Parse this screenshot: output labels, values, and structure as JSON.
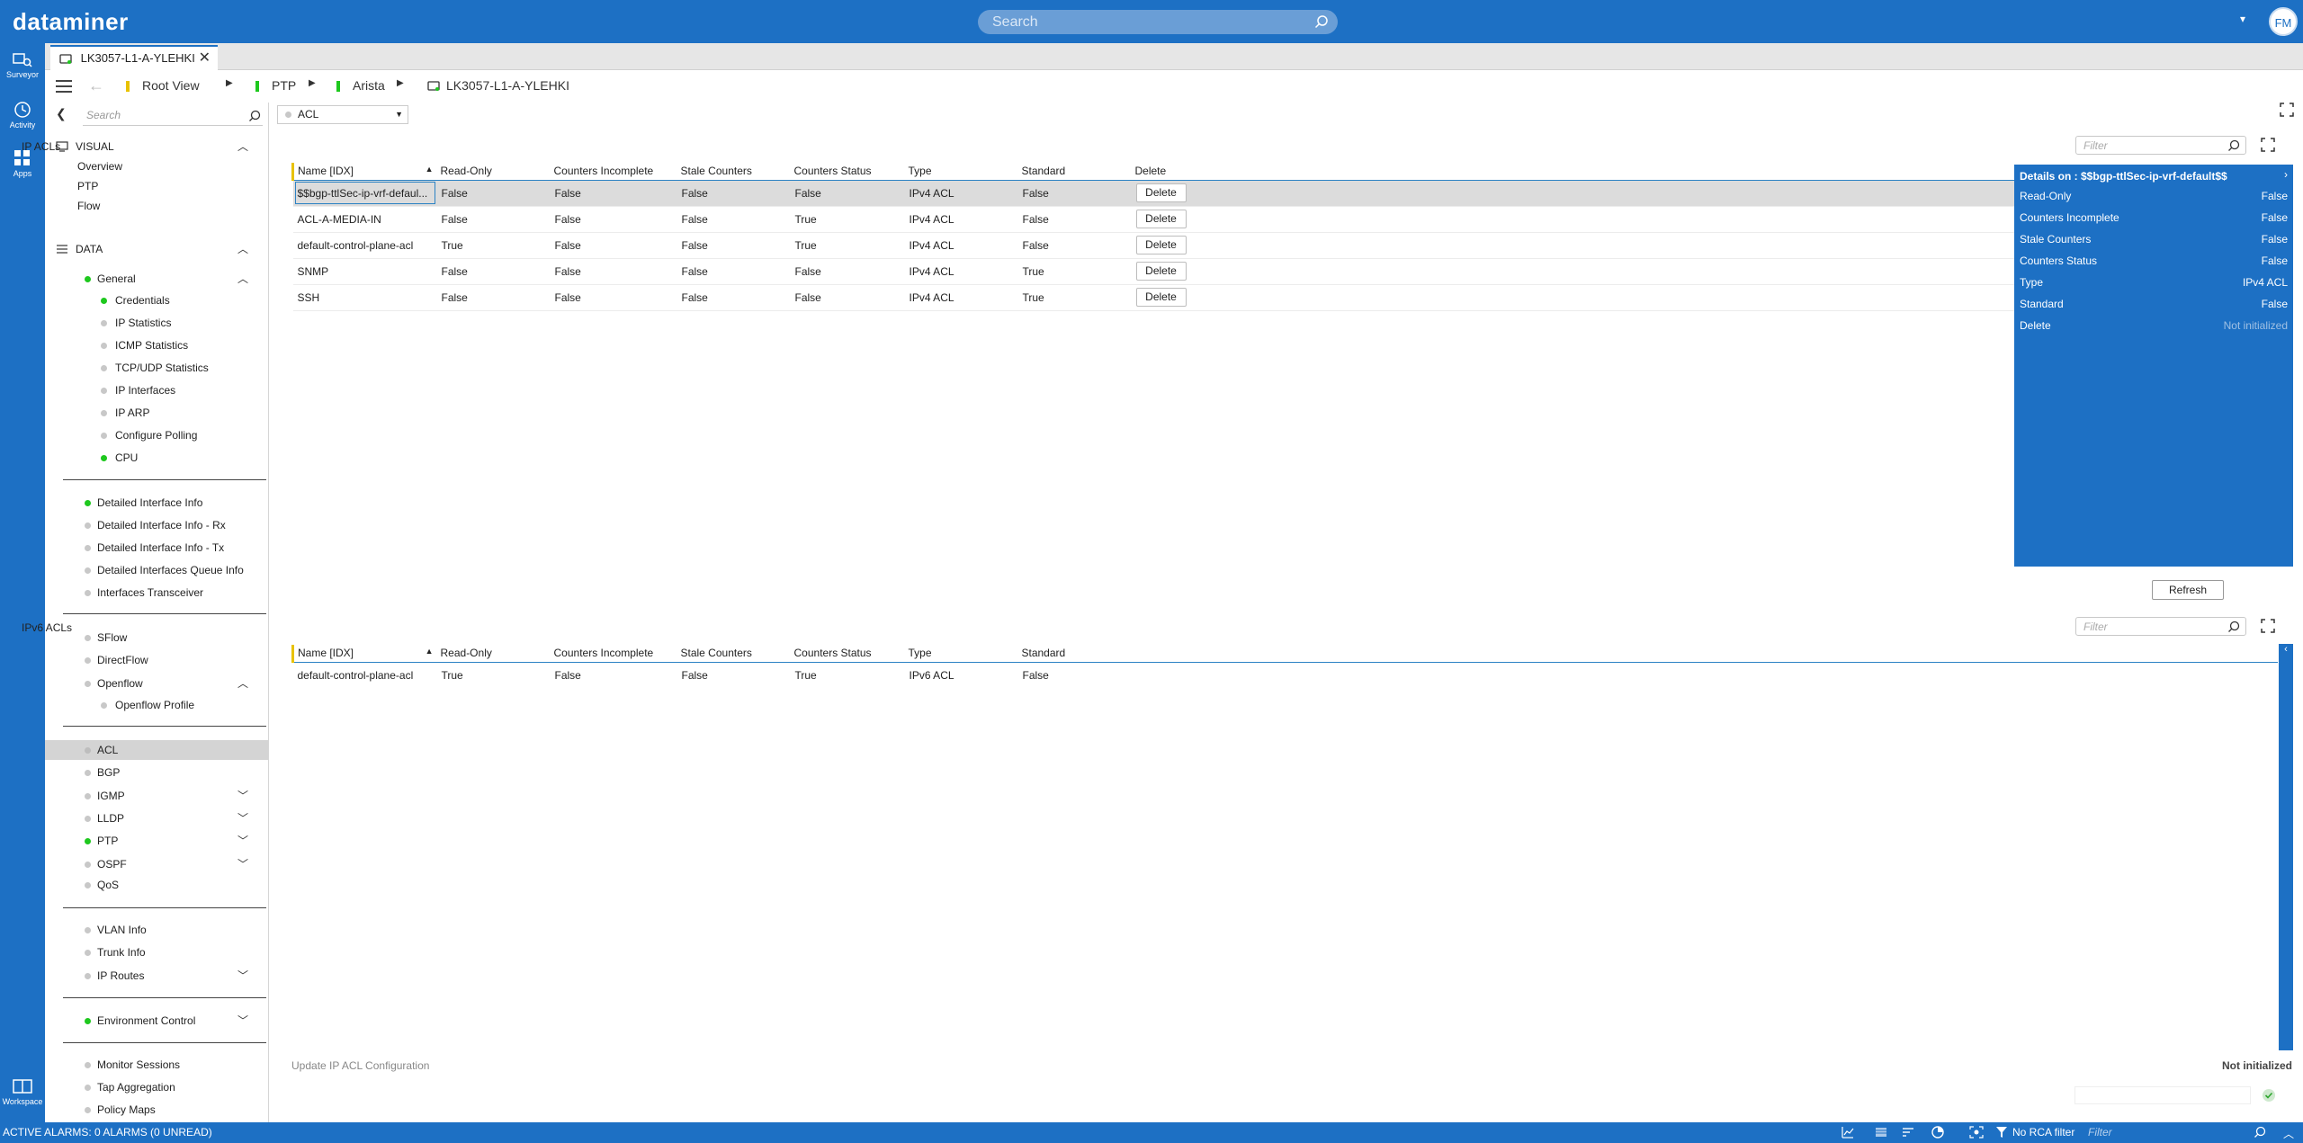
{
  "app": {
    "logo": "dataminer",
    "search_placeholder": "Search",
    "user_initials": "FM",
    "menu_arrow": "▾"
  },
  "rail": {
    "surveyor": "Surveyor",
    "activity": "Activity",
    "apps": "Apps",
    "workspace": "Workspace"
  },
  "tab": {
    "label": "LK3057-L1-A-YLEHKI",
    "close": "✕"
  },
  "breadcrumb": {
    "root": "Root View",
    "ptp": "PTP",
    "arista": "Arista",
    "element": "LK3057-L1-A-YLEHKI"
  },
  "sidebar": {
    "search_placeholder": "Search",
    "visual_header": "VISUAL",
    "visual_items": [
      "Overview",
      "PTP",
      "Flow"
    ],
    "data_header": "DATA",
    "general": "General",
    "general_items": [
      "Credentials",
      "IP Statistics",
      "ICMP Statistics",
      "TCP/UDP Statistics",
      "IP Interfaces",
      "IP ARP",
      "Configure Polling",
      "CPU"
    ],
    "group2": [
      "Detailed Interface Info",
      "Detailed Interface Info - Rx",
      "Detailed Interface Info - Tx",
      "Detailed Interfaces Queue Info",
      "Interfaces Transceiver"
    ],
    "group3": [
      "SFlow",
      "DirectFlow",
      "Openflow"
    ],
    "openflow_child": "Openflow Profile",
    "group4": [
      "ACL",
      "BGP",
      "IGMP",
      "LLDP",
      "PTP",
      "OSPF",
      "QoS"
    ],
    "group5": [
      "VLAN Info",
      "Trunk Info",
      "IP Routes"
    ],
    "group6": [
      "Environment Control"
    ],
    "group7": [
      "Monitor Sessions",
      "Tap Aggregation",
      "Policy Maps"
    ]
  },
  "page_select": {
    "value": "ACL"
  },
  "ip_acls": {
    "title": "IP ACLs",
    "filter_placeholder": "Filter",
    "columns": [
      "Name [IDX]",
      "Read-Only",
      "Counters Incomplete",
      "Stale Counters",
      "Counters Status",
      "Type",
      "Standard",
      "Delete"
    ],
    "delete_label": "Delete",
    "rows": [
      [
        "$$bgp-ttlSec-ip-vrf-defaul...",
        "False",
        "False",
        "False",
        "False",
        "IPv4 ACL",
        "False"
      ],
      [
        "ACL-A-MEDIA-IN",
        "False",
        "False",
        "False",
        "True",
        "IPv4 ACL",
        "False"
      ],
      [
        "default-control-plane-acl",
        "True",
        "False",
        "False",
        "True",
        "IPv4 ACL",
        "False"
      ],
      [
        "SNMP",
        "False",
        "False",
        "False",
        "False",
        "IPv4 ACL",
        "True"
      ],
      [
        "SSH",
        "False",
        "False",
        "False",
        "False",
        "IPv4 ACL",
        "True"
      ]
    ]
  },
  "details": {
    "title": "Details on : $$bgp-ttlSec-ip-vrf-default$$",
    "rows": [
      {
        "k": "Read-Only",
        "v": "False"
      },
      {
        "k": "Counters Incomplete",
        "v": "False"
      },
      {
        "k": "Stale Counters",
        "v": "False"
      },
      {
        "k": "Counters Status",
        "v": "False"
      },
      {
        "k": "Type",
        "v": "IPv4 ACL"
      },
      {
        "k": "Standard",
        "v": "False"
      },
      {
        "k": "Delete",
        "v": "Not initialized"
      }
    ],
    "refresh": "Refresh"
  },
  "ipv6_acls": {
    "title": "IPv6 ACLs",
    "filter_placeholder": "Filter",
    "columns": [
      "Name [IDX]",
      "Read-Only",
      "Counters Incomplete",
      "Stale Counters",
      "Counters Status",
      "Type",
      "Standard"
    ],
    "rows": [
      [
        "default-control-plane-acl",
        "True",
        "False",
        "False",
        "True",
        "IPv6 ACL",
        "False"
      ]
    ]
  },
  "update": {
    "label": "Update IP ACL Configuration",
    "status": "Not initialized"
  },
  "statusbar": {
    "alarms": "ACTIVE ALARMS: 0 ALARMS (0 UNREAD)",
    "rca": "No RCA filter",
    "filter_placeholder": "Filter"
  },
  "colors": {
    "brand": "#1d70c4",
    "green": "#1ec81e",
    "yellow": "#e8c200"
  }
}
